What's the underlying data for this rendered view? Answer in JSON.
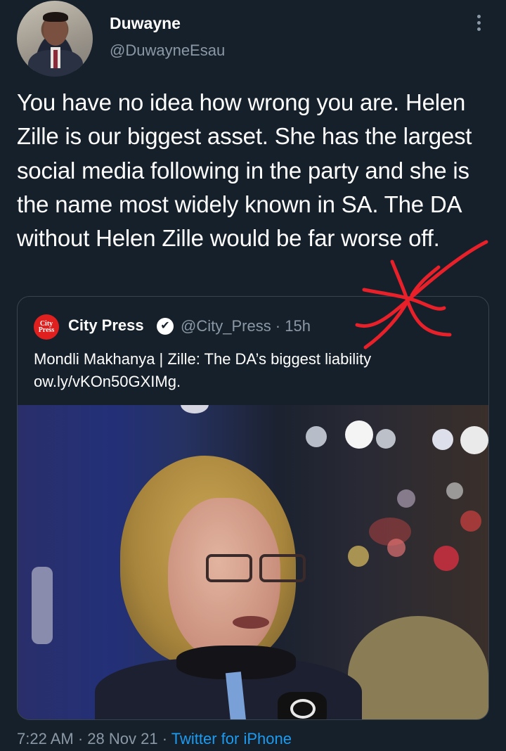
{
  "tweet": {
    "author": {
      "display_name": "Duwayne",
      "handle": "@DuwayneEsau"
    },
    "text": "You have no idea how wrong you are. Helen Zille is our biggest asset. She has the largest social media following in the party and she is the name most widely known in SA. The DA without Helen Zille would be far worse off.",
    "time": "7:22 AM",
    "date": "28 Nov 21",
    "source": "Twitter for iPhone",
    "separator": "·"
  },
  "quoted_tweet": {
    "logo_text_1": "City",
    "logo_text_2": "Press",
    "author_name": "City Press",
    "verified_mark": "✔",
    "handle_and_time": "@City_Press · 15h",
    "text": "Mondli Makhanya | Zille: The DA’s biggest liability ow.ly/vKOn50GXIMg."
  },
  "icons": {
    "more": "more-options-icon",
    "verified": "verified-badge-icon"
  },
  "colors": {
    "background": "#15202b",
    "secondary_text": "#8b98a5",
    "link": "#1d9bf0",
    "border": "#38444d",
    "annotation": "#e8202a",
    "brand_logo": "#e0201f"
  }
}
